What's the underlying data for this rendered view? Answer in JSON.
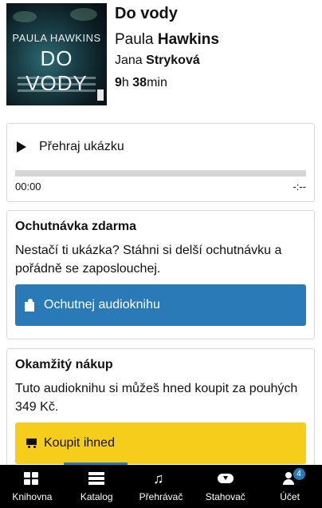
{
  "book": {
    "cover": {
      "author_text": "PAULA HAWKINS",
      "title_text": "DO VODY"
    },
    "title": "Do vody",
    "author_first": "Paula",
    "author_last": "Hawkins",
    "narrator_first": "Jana",
    "narrator_last": "Stryková",
    "duration_hours": "9",
    "duration_hours_unit": "h",
    "duration_minutes": "38",
    "duration_minutes_unit": "min"
  },
  "player": {
    "play_label": "Přehraj ukázku",
    "current_time": "00:00",
    "total_time": "-:--",
    "progress": 0
  },
  "sample": {
    "heading": "Ochutnávka zdarma",
    "description": "Nestačí ti ukázka? Stáhni si delší ochutnávku a pořádně se zaposlouchej.",
    "button_label": "Ochutnej audioknihu",
    "button_icon": "puzzle-icon",
    "button_color": "#2a7ab8"
  },
  "buy": {
    "heading": "Okamžitý nákup",
    "description": "Tuto audioknihu si můžeš hned koupit za pouhých 349 Kč.",
    "button_label": "Koupit ihned",
    "button_icon": "cart-icon",
    "button_color": "#f5cd1a"
  },
  "nav": {
    "items": [
      {
        "label": "Knihovna",
        "icon": "grid-icon"
      },
      {
        "label": "Katalog",
        "icon": "list-icon",
        "active": true
      },
      {
        "label": "Přehrávač",
        "icon": "music-icon"
      },
      {
        "label": "Stahovač",
        "icon": "cloud-download-icon"
      },
      {
        "label": "Účet",
        "icon": "user-icon",
        "badge": "4"
      }
    ],
    "accent": "#2a7ab8"
  }
}
